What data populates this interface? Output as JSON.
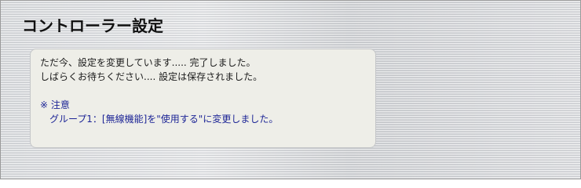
{
  "page": {
    "title": "コントローラー設定"
  },
  "message": {
    "line1": "ただ今、設定を変更しています..... 完了しました。",
    "line2": "しばらくお待ちください.... 設定は保存されました。"
  },
  "note": {
    "heading": "※ 注意",
    "text": "グループ1：[無線機能]を\"使用する\"に変更しました。"
  },
  "colors": {
    "note_text": "#1d2596",
    "panel_background": "#eeeee8",
    "title_text": "#111111"
  }
}
